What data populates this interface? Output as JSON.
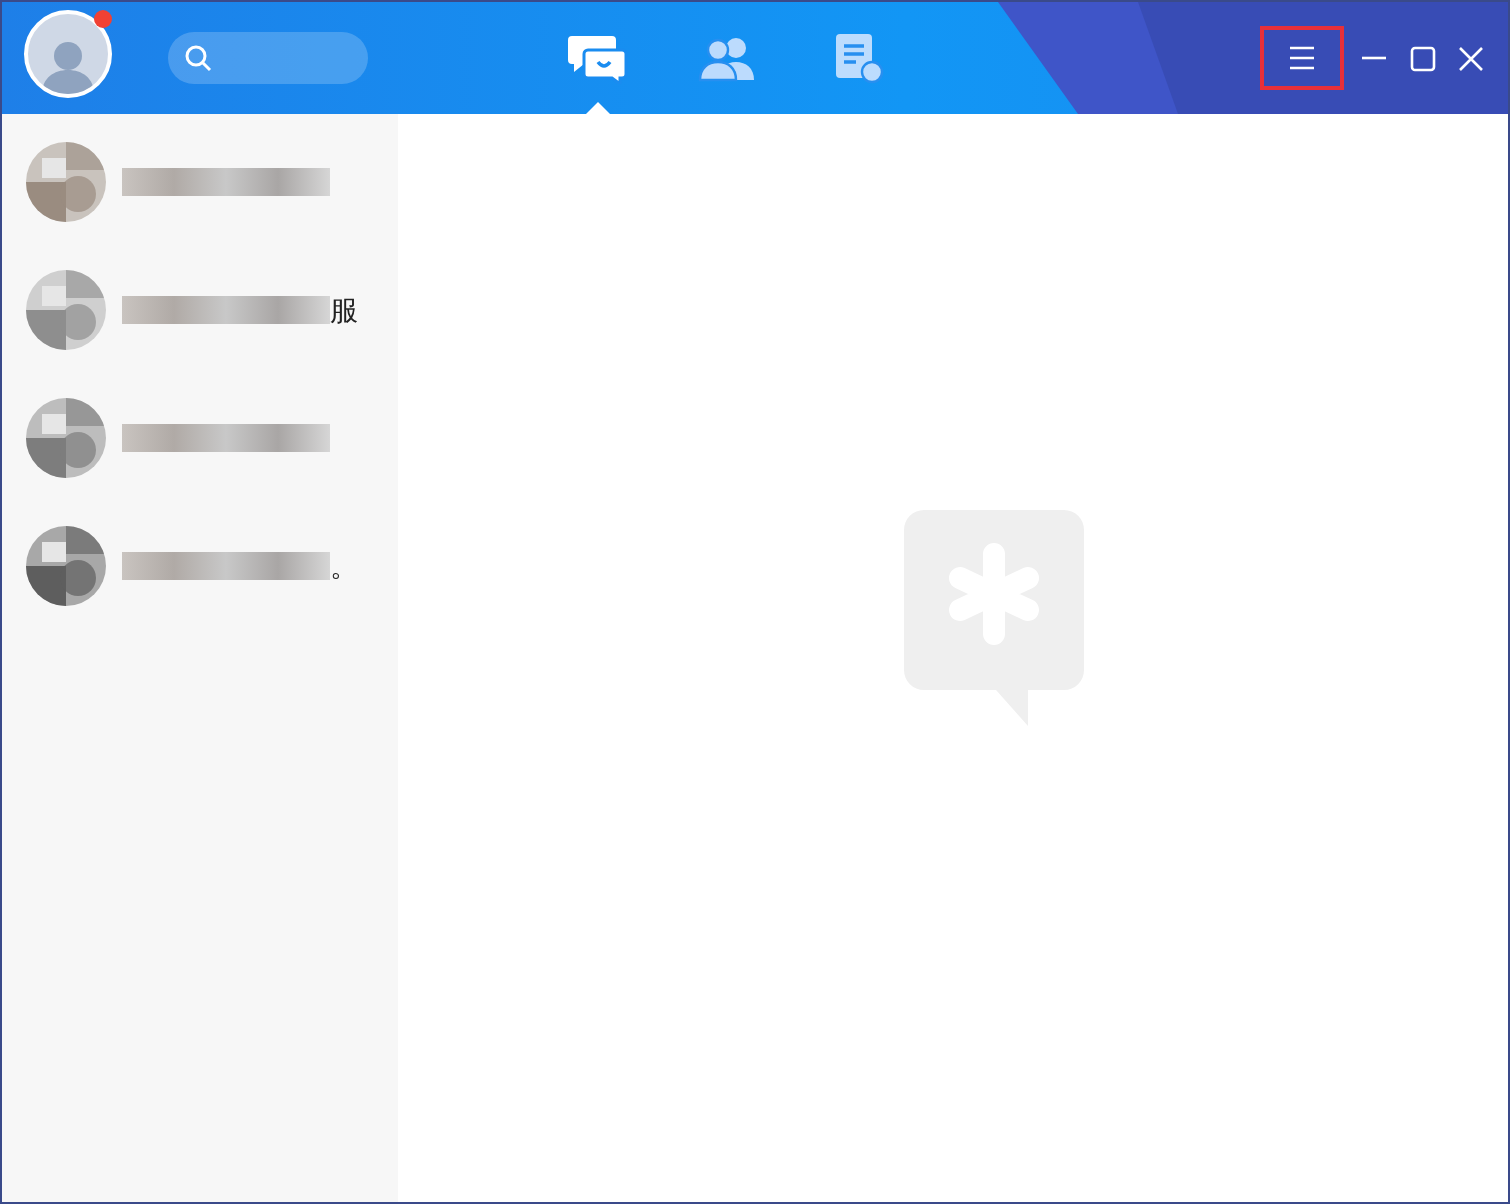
{
  "header": {
    "unread_dot": true
  },
  "tabs": [
    {
      "kind": "chats",
      "selected": true
    },
    {
      "kind": "contacts",
      "selected": false
    },
    {
      "kind": "files",
      "selected": false
    }
  ],
  "window_controls": [
    {
      "kind": "menu",
      "highlighted": true
    },
    {
      "kind": "minimize",
      "highlighted": false
    },
    {
      "kind": "maximize",
      "highlighted": false
    },
    {
      "kind": "close",
      "highlighted": false
    }
  ],
  "conversations": [
    {
      "avatar": {
        "kind": "picture"
      }
    },
    {
      "avatar": {
        "kind": "picture"
      },
      "name_tail": "服"
    },
    {
      "avatar": {
        "kind": "picture"
      }
    },
    {
      "avatar": {
        "kind": "picture"
      },
      "name_tail": "。"
    }
  ]
}
